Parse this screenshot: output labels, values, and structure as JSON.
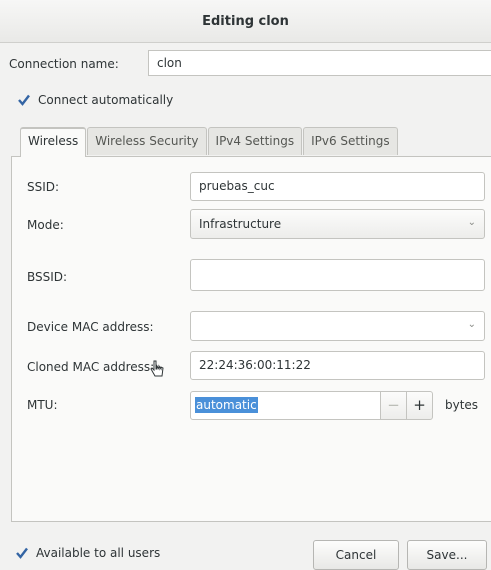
{
  "window": {
    "title": "Editing clon"
  },
  "connection": {
    "label": "Connection name:",
    "value": "clon"
  },
  "connect_automatically": {
    "label": "Connect automatically",
    "checked": true
  },
  "tabs": [
    {
      "label": "Wireless",
      "active": true
    },
    {
      "label": "Wireless Security",
      "active": false
    },
    {
      "label": "IPv4 Settings",
      "active": false
    },
    {
      "label": "IPv6 Settings",
      "active": false
    }
  ],
  "wireless": {
    "ssid": {
      "label": "SSID:",
      "value": "pruebas_cuc"
    },
    "mode": {
      "label": "Mode:",
      "value": "Infrastructure"
    },
    "bssid": {
      "label": "BSSID:",
      "value": ""
    },
    "device_mac": {
      "label": "Device MAC address:",
      "value": ""
    },
    "cloned_mac": {
      "label": "Cloned MAC address:",
      "value": "22:24:36:00:11:22"
    },
    "mtu": {
      "label": "MTU:",
      "value": "automatic",
      "unit": "bytes",
      "minus": "−",
      "plus": "+"
    }
  },
  "available_to_all_users": {
    "label": "Available to all users",
    "checked": true
  },
  "buttons": {
    "cancel": "Cancel",
    "save": "Save..."
  },
  "icons": {
    "checkbox": "checkmark-icon",
    "dropdown": "chevron-down-icon",
    "cursor": "hand-cursor-icon"
  },
  "colors": {
    "selection": "#4a90d9",
    "check": "#3465a4"
  }
}
